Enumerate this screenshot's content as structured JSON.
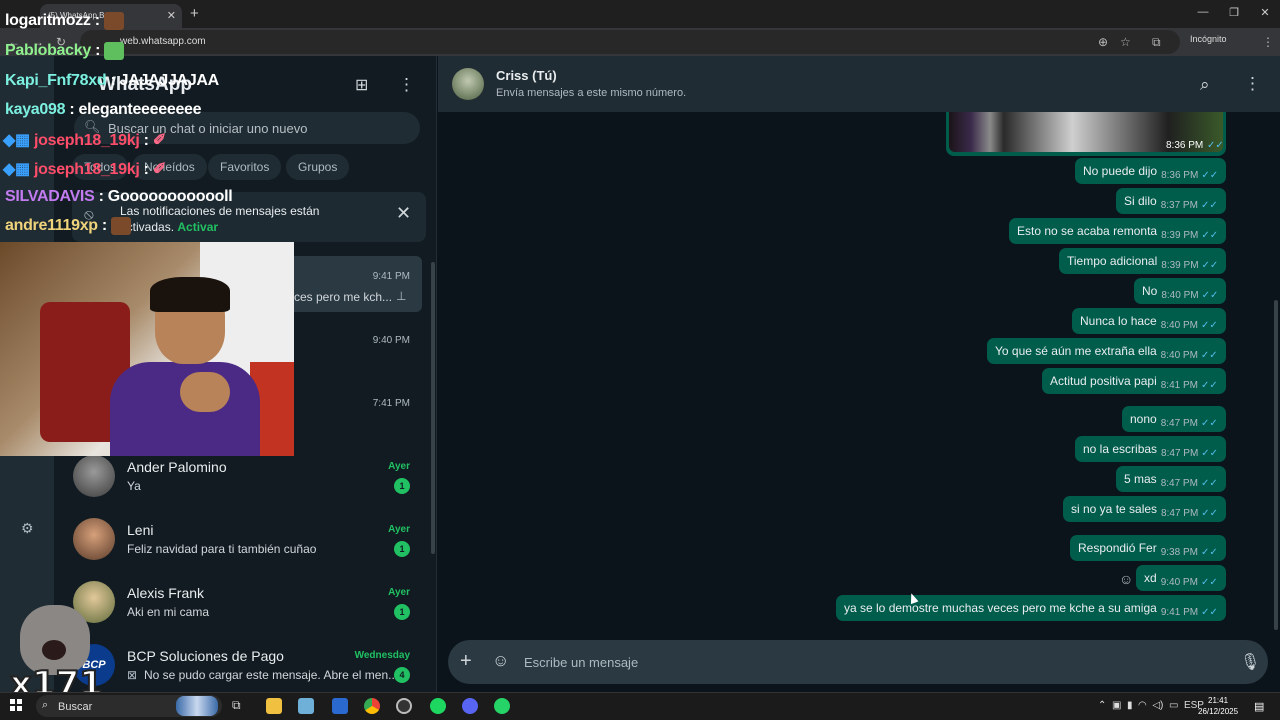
{
  "browser": {
    "tab_title": "(5) WhatsApp Bu...",
    "tab_close": "✕",
    "new_tab": "+",
    "url": "web.whatsapp.com",
    "profile_label": "Incógnito",
    "window_min": "—",
    "window_max": "❐",
    "window_close": "✕"
  },
  "sidebar": {
    "app_title": "WhatsApp",
    "search_placeholder": "Buscar un chat o iniciar uno nuevo",
    "filters": [
      "Todos",
      "No leídos",
      "Favoritos",
      "Grupos"
    ],
    "notification": {
      "line1": "Las notificaciones de mensajes están",
      "line2": "activadas.",
      "action": "Activar"
    },
    "partial_chats": [
      {
        "time": "9:41 PM",
        "preview": "ces pero me kch..."
      },
      {
        "time": "9:40 PM"
      },
      {
        "time": "7:41 PM"
      }
    ],
    "chats": [
      {
        "name": "Ander Palomino",
        "preview": "Ya",
        "time": "Ayer",
        "unread": "1"
      },
      {
        "name": "Leni",
        "preview": "Feliz navidad para ti también cuñao",
        "time": "Ayer",
        "unread": "1"
      },
      {
        "name": "Alexis Frank",
        "preview": "Aki en mi cama",
        "time": "Ayer",
        "unread": "1"
      },
      {
        "name": "BCP Soluciones de Pago",
        "preview": "No se pudo cargar este mensaje. Abre el men...",
        "time": "Wednesday",
        "unread": "4",
        "avatar_text": "BCP"
      }
    ]
  },
  "stream_overlay": {
    "lines": [
      {
        "user": "logaritmozz",
        "msg": ""
      },
      {
        "user": "Pablobacky",
        "msg": ""
      },
      {
        "user": "Kapi_Fnf78xd",
        "msg": "JAJAJJAJAA"
      },
      {
        "user": "kaya098",
        "msg": "eleganteeeeeeee"
      },
      {
        "user": "joseph18_19kj",
        "msg": ""
      },
      {
        "user": "joseph18_19kj",
        "msg": ""
      },
      {
        "user": "SILVADAVIS",
        "msg": "Goooooooooooll"
      },
      {
        "user": "andre1119xp",
        "msg": ""
      }
    ],
    "combo": "x171"
  },
  "chat": {
    "contact_name": "Criss (Tú)",
    "contact_sub": "Envía mensajes a este mismo número.",
    "image_time": "8:36 PM",
    "messages": [
      {
        "text": "No puede dijo",
        "time": "8:36 PM"
      },
      {
        "text": "Si dilo",
        "time": "8:37 PM"
      },
      {
        "text": "Esto no se acaba remonta",
        "time": "8:39 PM"
      },
      {
        "text": "Tiempo adicional",
        "time": "8:39 PM"
      },
      {
        "text": "No",
        "time": "8:40 PM"
      },
      {
        "text": "Nunca lo hace",
        "time": "8:40 PM"
      },
      {
        "text": "Yo que sé aún me extraña ella",
        "time": "8:40 PM"
      },
      {
        "text": "Actitud positiva papi",
        "time": "8:41 PM"
      },
      {
        "text": "nono",
        "time": "8:47 PM"
      },
      {
        "text": "no la escribas",
        "time": "8:47 PM"
      },
      {
        "text": "5 mas",
        "time": "8:47 PM"
      },
      {
        "text": "si no ya te sales",
        "time": "8:47 PM"
      },
      {
        "text": "Respondió Fer",
        "time": "9:38 PM"
      },
      {
        "text": "xd",
        "time": "9:40 PM"
      },
      {
        "text": "ya se lo demostre muchas veces pero me kche a su amiga",
        "time": "9:41 PM"
      }
    ],
    "compose_placeholder": "Escribe un mensaje"
  },
  "taskbar": {
    "search_label": "Buscar",
    "language": "ESP",
    "time": "21:41",
    "date": "26/12/2025"
  },
  "colors": {
    "accent": "#21c063",
    "outgoing_bubble": "#005c4b",
    "read_tick": "#53bdeb",
    "panel": "#111b21",
    "header": "#202c33"
  }
}
